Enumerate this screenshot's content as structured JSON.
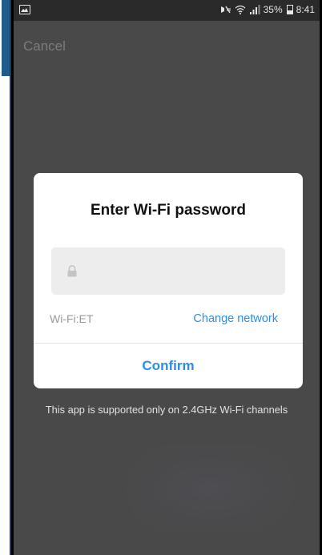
{
  "status_bar": {
    "battery": "35%",
    "time": "8:41",
    "icons": [
      "gallery-icon",
      "mute-vibrate-icon",
      "wifi-icon",
      "signal-icon",
      "battery-icon"
    ]
  },
  "header": {
    "cancel_label": "Cancel"
  },
  "dialog": {
    "title": "Enter Wi-Fi password",
    "password_value": "",
    "network_label": "Wi-Fi:ET",
    "change_network_label": "Change network",
    "confirm_label": "Confirm"
  },
  "note": "This app is supported only on 2.4GHz Wi-Fi channels",
  "colors": {
    "accent": "#2a8ee8",
    "overlay": "#494949",
    "dialog_bg": "#ffffff"
  }
}
